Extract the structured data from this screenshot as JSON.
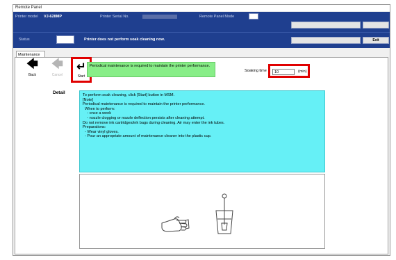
{
  "window": {
    "title": "Remote Panel"
  },
  "header": {
    "printer_model_label": "Printer model",
    "printer_model_value": "VJ-628MP",
    "printer_serial_label": "Printer Serial No.",
    "remote_panel_mode_label": "Remote Panel Mode",
    "status_label": "Status",
    "status_message": "Printer does not perform soak cleaning now.",
    "btn_disabled_1": "",
    "btn_disabled_2": "",
    "btn_disabled_3": "",
    "btn_disabled_4": "",
    "exit_label": "Exit"
  },
  "tabs": {
    "maintenance": "Maintenance"
  },
  "toolbar": {
    "back_label": "Back",
    "cancel_label": "Cancel",
    "start_label": "Start",
    "message": "Periodical maintenance is required to maintain the printer performance."
  },
  "soaking": {
    "label": "Soaking time",
    "value": "10",
    "unit": "(min)"
  },
  "detail": {
    "label": "Detail",
    "lines": [
      "To perform soak cleaning, click [Start] button in MSM.",
      "",
      "[Note]",
      "Periodical maintenance is required to maintain the printer performance.",
      "  When to perform:",
      "    - once a week",
      "    - nozzle clogging or nozzle deflection persists after cleaning attempt.",
      "Do not remove ink cartridges/ink bags during cleaning. Air may enter the ink tubes.",
      "",
      "Preparations:",
      "  - Wear vinyl gloves.",
      "  - Pour an appropriate amount of maintenance cleaner into the plastic cup."
    ]
  },
  "icons": {
    "glove": "glove-icon",
    "cup": "cleaning-cup-icon"
  }
}
